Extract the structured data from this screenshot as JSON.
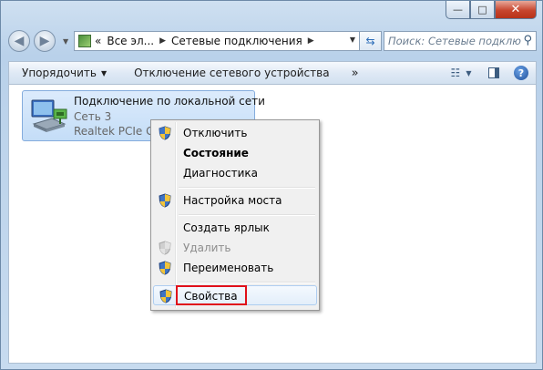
{
  "window": {
    "minimize_label": "—",
    "maximize_label": "□",
    "close_label": "✕"
  },
  "nav": {
    "breadcrumb_prefix": "«",
    "breadcrumb": [
      "Все эл...",
      "Сетевые подключения"
    ],
    "search_placeholder": "Поиск: Сетевые подклю..."
  },
  "toolbar": {
    "organize_label": "Упорядочить",
    "disconnect_label": "Отключение сетевого устройства",
    "more_label": "»"
  },
  "connection": {
    "title": "Подключение по локальной сети",
    "network": "Сеть  3",
    "adapter": "Realtek PCIe GBE"
  },
  "context_menu": {
    "items": [
      {
        "label": "Отключить",
        "shield": true,
        "bold": false,
        "disabled": false
      },
      {
        "label": "Состояние",
        "shield": false,
        "bold": true,
        "disabled": false
      },
      {
        "label": "Диагностика",
        "shield": false,
        "bold": false,
        "disabled": false
      },
      {
        "label": "Настройка моста",
        "shield": true,
        "bold": false,
        "disabled": false
      },
      {
        "label": "Создать ярлык",
        "shield": false,
        "bold": false,
        "disabled": false
      },
      {
        "label": "Удалить",
        "shield": true,
        "bold": false,
        "disabled": true
      },
      {
        "label": "Переименовать",
        "shield": true,
        "bold": false,
        "disabled": false
      },
      {
        "label": "Свойства",
        "shield": true,
        "bold": false,
        "disabled": false,
        "highlighted": true
      }
    ]
  },
  "colors": {
    "highlight_border": "#e0101a",
    "selection_fill": "#c4ddf7"
  }
}
